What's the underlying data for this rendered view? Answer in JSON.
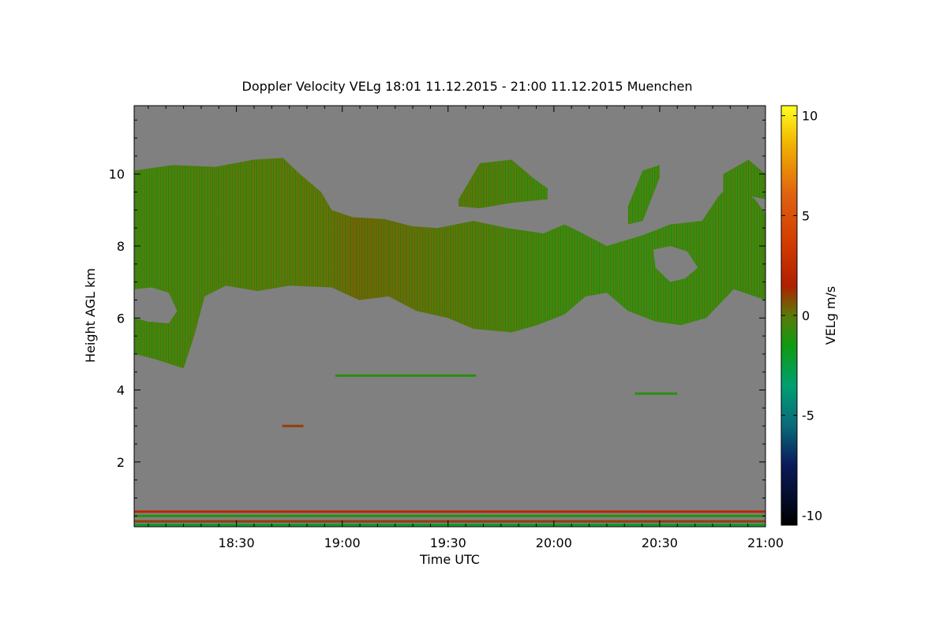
{
  "chart_data": {
    "type": "heatmap",
    "title": "Doppler Velocity VELg   18:01 11.12.2015 - 21:00 11.12.2015 Muenchen",
    "xlabel": "Time UTC",
    "ylabel": "Height AGL km",
    "xlim": [
      "18:01",
      "21:00"
    ],
    "ylim": [
      0.2,
      11.9
    ],
    "x_ticks": [
      "18:30",
      "19:00",
      "19:30",
      "20:00",
      "20:30",
      "21:00"
    ],
    "y_ticks": [
      2,
      4,
      6,
      8,
      10
    ],
    "colorbar": {
      "label": "VELg m/s",
      "range": [
        -10.5,
        10.5
      ],
      "ticks": [
        -10,
        -5,
        0,
        5,
        10
      ],
      "stops": [
        {
          "value": -10.5,
          "color": "#000000"
        },
        {
          "value": -7.5,
          "color": "#0a1a5a"
        },
        {
          "value": -5.5,
          "color": "#0a6a7a"
        },
        {
          "value": -3.5,
          "color": "#00a070"
        },
        {
          "value": -1.5,
          "color": "#109a10"
        },
        {
          "value": 0,
          "color": "#5a7a0a"
        },
        {
          "value": 1.5,
          "color": "#b02000"
        },
        {
          "value": 3.5,
          "color": "#d03a00"
        },
        {
          "value": 6,
          "color": "#e06010"
        },
        {
          "value": 8.5,
          "color": "#f0b000"
        },
        {
          "value": 10.5,
          "color": "#ffff20"
        }
      ]
    },
    "background_color": "#808080",
    "features": [
      {
        "name": "upper ice cloud",
        "type": "cloud_layer",
        "velocity": -1,
        "time_start": "18:01",
        "time_end": "21:00",
        "top": [
          [
            18.02,
            10.1
          ],
          [
            18.2,
            10.25
          ],
          [
            18.4,
            10.2
          ],
          [
            18.58,
            10.4
          ],
          [
            18.72,
            10.45
          ],
          [
            18.8,
            10.0
          ],
          [
            18.9,
            9.5
          ],
          [
            18.95,
            9.0
          ],
          [
            19.05,
            8.8
          ],
          [
            19.2,
            8.75
          ],
          [
            19.33,
            8.55
          ],
          [
            19.45,
            8.5
          ],
          [
            19.62,
            8.7
          ],
          [
            19.78,
            8.5
          ],
          [
            19.95,
            8.35
          ],
          [
            20.05,
            8.6
          ],
          [
            20.12,
            8.4
          ],
          [
            20.25,
            8.0
          ],
          [
            20.42,
            8.3
          ],
          [
            20.55,
            8.6
          ],
          [
            20.7,
            8.7
          ],
          [
            20.78,
            9.4
          ],
          [
            20.85,
            9.8
          ],
          [
            20.95,
            9.3
          ],
          [
            21.0,
            8.9
          ]
        ],
        "base": [
          [
            18.02,
            5.0
          ],
          [
            18.12,
            4.85
          ],
          [
            18.25,
            4.6
          ],
          [
            18.3,
            5.5
          ],
          [
            18.35,
            6.6
          ],
          [
            18.45,
            6.9
          ],
          [
            18.6,
            6.75
          ],
          [
            18.75,
            6.9
          ],
          [
            18.95,
            6.85
          ],
          [
            19.08,
            6.5
          ],
          [
            19.22,
            6.6
          ],
          [
            19.35,
            6.2
          ],
          [
            19.5,
            6.0
          ],
          [
            19.62,
            5.7
          ],
          [
            19.8,
            5.6
          ],
          [
            19.92,
            5.8
          ],
          [
            20.05,
            6.1
          ],
          [
            20.15,
            6.6
          ],
          [
            20.25,
            6.7
          ],
          [
            20.35,
            6.2
          ],
          [
            20.48,
            5.9
          ],
          [
            20.6,
            5.8
          ],
          [
            20.72,
            6.0
          ],
          [
            20.85,
            6.8
          ],
          [
            21.0,
            6.5
          ]
        ],
        "holes": [
          [
            [
              18.02,
              6.8
            ],
            [
              18.1,
              6.85
            ],
            [
              18.18,
              6.7
            ],
            [
              18.22,
              6.2
            ],
            [
              18.18,
              5.85
            ],
            [
              18.08,
              5.9
            ],
            [
              18.02,
              6.0
            ]
          ],
          [
            [
              20.47,
              7.9
            ],
            [
              20.55,
              8.0
            ],
            [
              20.63,
              7.85
            ],
            [
              20.68,
              7.4
            ],
            [
              20.62,
              7.1
            ],
            [
              20.55,
              7.0
            ],
            [
              20.48,
              7.4
            ]
          ]
        ]
      },
      {
        "name": "cirrus fragment",
        "type": "cloud_layer",
        "velocity": -1,
        "top": [
          [
            19.55,
            9.3
          ],
          [
            19.65,
            10.3
          ],
          [
            19.8,
            10.4
          ],
          [
            19.9,
            9.9
          ],
          [
            19.97,
            9.6
          ]
        ],
        "base": [
          [
            19.55,
            9.1
          ],
          [
            19.65,
            9.05
          ],
          [
            19.8,
            9.2
          ],
          [
            19.97,
            9.3
          ]
        ]
      },
      {
        "name": "cirrus fragment",
        "type": "cloud_layer",
        "velocity": -1,
        "top": [
          [
            20.35,
            9.1
          ],
          [
            20.42,
            10.1
          ],
          [
            20.5,
            10.25
          ]
        ],
        "base": [
          [
            20.35,
            8.6
          ],
          [
            20.42,
            8.7
          ],
          [
            20.5,
            9.9
          ]
        ]
      },
      {
        "name": "cirrus fragment",
        "type": "cloud_layer",
        "velocity": -1,
        "top": [
          [
            20.8,
            10.0
          ],
          [
            20.92,
            10.4
          ],
          [
            21.0,
            10.0
          ]
        ],
        "base": [
          [
            20.8,
            9.2
          ],
          [
            20.92,
            9.4
          ],
          [
            21.0,
            9.3
          ]
        ]
      },
      {
        "name": "thin layer",
        "type": "streak",
        "velocity": -1,
        "time_start": "18:58",
        "time_end": "19:38",
        "height": 4.4
      },
      {
        "name": "thin layer",
        "type": "streak",
        "velocity": 1,
        "time_start": "18:43",
        "time_end": "18:49",
        "height": 3.0
      },
      {
        "name": "thin layer",
        "type": "streak",
        "velocity": -1,
        "time_start": "20:23",
        "time_end": "20:35",
        "height": 3.9
      },
      {
        "name": "near-surface band",
        "type": "streak",
        "velocity": 2,
        "time_start": "18:01",
        "time_end": "21:00",
        "height": 0.62
      },
      {
        "name": "near-surface band",
        "type": "streak",
        "velocity": -1,
        "time_start": "18:01",
        "time_end": "21:00",
        "height": 0.5
      },
      {
        "name": "near-surface band",
        "type": "streak",
        "velocity": 1,
        "time_start": "18:01",
        "time_end": "21:00",
        "height": 0.35
      },
      {
        "name": "near-surface band",
        "type": "streak",
        "velocity": -2,
        "time_start": "18:01",
        "time_end": "21:00",
        "height": 0.25
      }
    ]
  }
}
